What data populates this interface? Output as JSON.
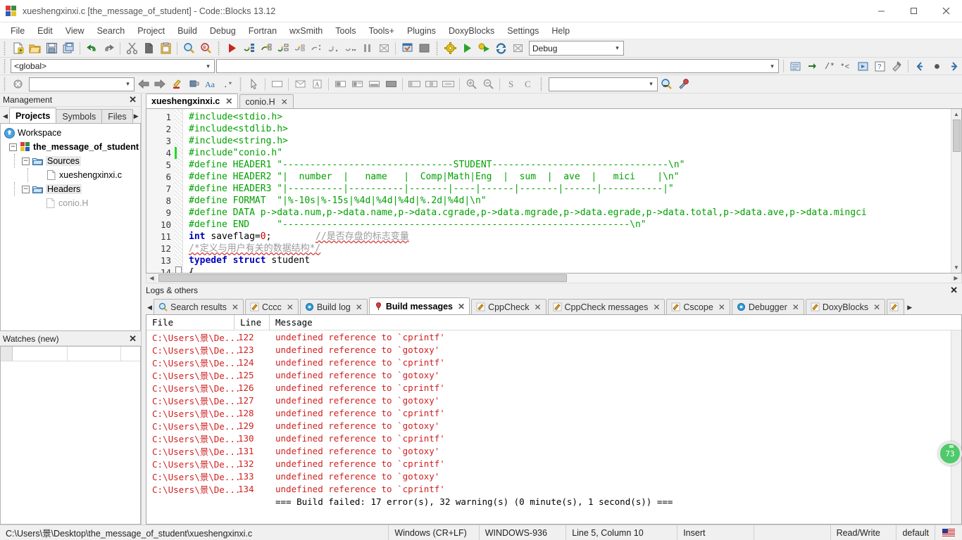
{
  "window": {
    "title": "xueshengxinxi.c [the_message_of_student] - Code::Blocks 13.12",
    "minimize": "–",
    "maximize": "❐",
    "close": "✕"
  },
  "menubar": {
    "items": [
      "File",
      "Edit",
      "View",
      "Search",
      "Project",
      "Build",
      "Debug",
      "Fortran",
      "wxSmith",
      "Tools",
      "Tools+",
      "Plugins",
      "DoxyBlocks",
      "Settings",
      "Help"
    ]
  },
  "toolbar": {
    "scope_combo": "<global>",
    "target_combo": "Debug",
    "find_value": "",
    "goto_value": "",
    "symbol_value": ""
  },
  "management": {
    "title": "Management",
    "close": "✕",
    "tabs": [
      "Projects",
      "Symbols",
      "Files"
    ],
    "active_tab": "Projects",
    "tree": {
      "workspace": "Workspace",
      "project": "the_message_of_student",
      "sources_folder": "Sources",
      "source_file": "xueshengxinxi.c",
      "headers_folder": "Headers",
      "header_file": "conio.H"
    }
  },
  "watches": {
    "title": "Watches (new)",
    "close": "✕"
  },
  "editor": {
    "tabs": [
      {
        "label": "xueshengxinxi.c",
        "close": "✕",
        "active": true
      },
      {
        "label": "conio.H",
        "close": "✕",
        "active": false
      }
    ],
    "lines": [
      {
        "num": "1",
        "segments": [
          {
            "t": "#include<stdio.h>",
            "c": "green"
          }
        ]
      },
      {
        "num": "2",
        "segments": [
          {
            "t": "#include<stdlib.h>",
            "c": "green"
          }
        ]
      },
      {
        "num": "3",
        "segments": [
          {
            "t": "#include<string.h>",
            "c": "green"
          }
        ]
      },
      {
        "num": "4",
        "segments": [
          {
            "t": "#include\"conio.h\"",
            "c": "green"
          }
        ]
      },
      {
        "num": "5",
        "segments": [
          {
            "t": "#define HEADER1 \"-------------------------------STUDENT--------------------------------\\n\"",
            "c": "green"
          }
        ]
      },
      {
        "num": "6",
        "segments": [
          {
            "t": "#define HEADER2 \"|  number  |   name   |  Comp|Math|Eng  |  sum  |  ave  |   mici    |\\n\"",
            "c": "green"
          }
        ]
      },
      {
        "num": "7",
        "segments": [
          {
            "t": "#define HEADER3 \"|----------|----------|-------|----|------|-------|------|-----------|\"",
            "c": "green"
          }
        ]
      },
      {
        "num": "8",
        "segments": [
          {
            "t": "#define FORMAT  \"|%-10s|%-15s|%4d|%4d|%4d|%.2d|%4d|\\n\"",
            "c": "green"
          }
        ]
      },
      {
        "num": "9",
        "segments": [
          {
            "t": "#define DATA p->data.num,p->data.name,p->data.cgrade,p->data.mgrade,p->data.egrade,p->data.total,p->data.ave,p->data.mingci",
            "c": "green"
          }
        ]
      },
      {
        "num": "10",
        "segments": [
          {
            "t": "#define END     \"---------------------------------------------------------------\\n\"",
            "c": "green"
          }
        ]
      },
      {
        "num": "11",
        "segments": [
          {
            "t": "int ",
            "c": "blue"
          },
          {
            "t": "saveflag=",
            "c": "black"
          },
          {
            "t": "0",
            "c": "red"
          },
          {
            "t": ";        ",
            "c": "black"
          },
          {
            "t": "//是否存盘的标志变量",
            "c": "gray squig"
          }
        ]
      },
      {
        "num": "12",
        "segments": [
          {
            "t": "/*定义与用户有关的数据结构*/",
            "c": "gray squig"
          }
        ]
      },
      {
        "num": "13",
        "segments": [
          {
            "t": "typedef struct ",
            "c": "blue"
          },
          {
            "t": "student",
            "c": "black"
          }
        ]
      },
      {
        "num": "14",
        "segments": [
          {
            "t": "{",
            "c": "black"
          }
        ]
      }
    ]
  },
  "logs": {
    "title": "Logs & others",
    "close": "✕",
    "tabs": [
      {
        "label": "Search results",
        "icon": "search-icon",
        "active": false
      },
      {
        "label": "Cccc",
        "icon": "pencil-icon",
        "active": false
      },
      {
        "label": "Build log",
        "icon": "gear-blue-icon",
        "active": false
      },
      {
        "label": "Build messages",
        "icon": "pin-icon",
        "active": true
      },
      {
        "label": "CppCheck",
        "icon": "pencil-icon",
        "active": false
      },
      {
        "label": "CppCheck messages",
        "icon": "pencil-icon",
        "active": false
      },
      {
        "label": "Cscope",
        "icon": "pencil-icon",
        "active": false
      },
      {
        "label": "Debugger",
        "icon": "gear-blue-icon",
        "active": false
      },
      {
        "label": "DoxyBlocks",
        "icon": "pencil-icon",
        "active": false
      }
    ],
    "columns": [
      "File",
      "Line",
      "Message"
    ],
    "rows": [
      {
        "file": "C:\\Users\\景\\De...",
        "line": "122",
        "message": "undefined reference to `cprintf'"
      },
      {
        "file": "C:\\Users\\景\\De...",
        "line": "123",
        "message": "undefined reference to `gotoxy'"
      },
      {
        "file": "C:\\Users\\景\\De...",
        "line": "124",
        "message": "undefined reference to `cprintf'"
      },
      {
        "file": "C:\\Users\\景\\De...",
        "line": "125",
        "message": "undefined reference to `gotoxy'"
      },
      {
        "file": "C:\\Users\\景\\De...",
        "line": "126",
        "message": "undefined reference to `cprintf'"
      },
      {
        "file": "C:\\Users\\景\\De...",
        "line": "127",
        "message": "undefined reference to `gotoxy'"
      },
      {
        "file": "C:\\Users\\景\\De...",
        "line": "128",
        "message": "undefined reference to `cprintf'"
      },
      {
        "file": "C:\\Users\\景\\De...",
        "line": "129",
        "message": "undefined reference to `gotoxy'"
      },
      {
        "file": "C:\\Users\\景\\De...",
        "line": "130",
        "message": "undefined reference to `cprintf'"
      },
      {
        "file": "C:\\Users\\景\\De...",
        "line": "131",
        "message": "undefined reference to `gotoxy'"
      },
      {
        "file": "C:\\Users\\景\\De...",
        "line": "132",
        "message": "undefined reference to `cprintf'"
      },
      {
        "file": "C:\\Users\\景\\De...",
        "line": "133",
        "message": "undefined reference to `gotoxy'"
      },
      {
        "file": "C:\\Users\\景\\De...",
        "line": "134",
        "message": "undefined reference to `cprintf'"
      }
    ],
    "summary": "=== Build failed: 17 error(s), 32 warning(s) (0 minute(s), 1 second(s)) ==="
  },
  "statusbar": {
    "path": "C:\\Users\\景\\Desktop\\the_message_of_student\\xueshengxinxi.c",
    "eol": "Windows (CR+LF)",
    "encoding": "WINDOWS-936",
    "caret": "Line 5, Column 10",
    "mode": "Insert",
    "empty": "",
    "access": "Read/Write",
    "profile": "default"
  },
  "float_badge": {
    "value": "73"
  },
  "colors": {
    "accent": "#4fca6a",
    "error": "#d02020",
    "comment": "#00a000",
    "keyword": "#0000c0"
  }
}
